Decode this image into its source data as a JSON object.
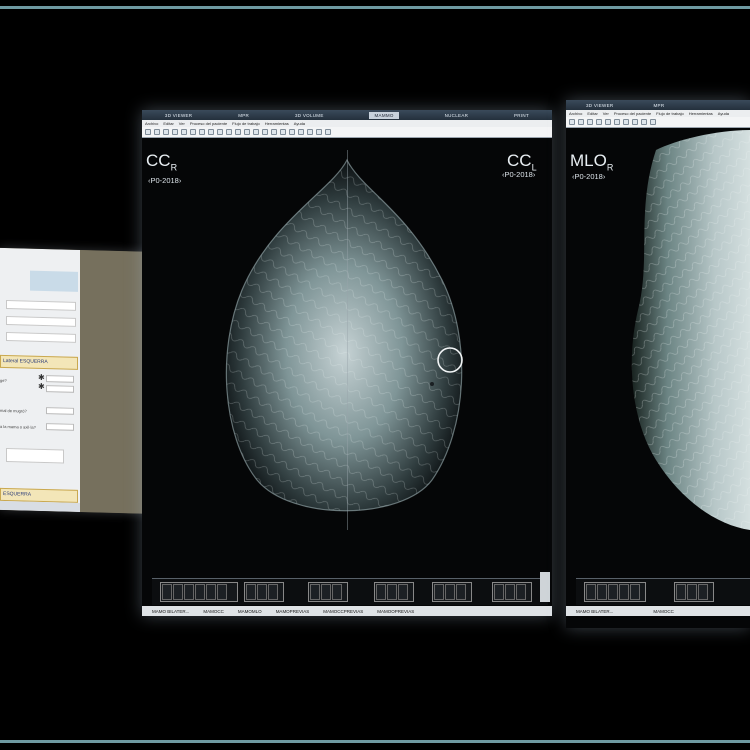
{
  "form": {
    "section_1": "Lateral ESQUERRA",
    "section_2": "ESQUERRA",
    "questions": [
      "ge?",
      "mal de mugró?",
      "a la mama o axil·la?"
    ]
  },
  "pacs": {
    "tabs": [
      "3D VIEWER",
      "MPR",
      "3D VOLUME",
      "MAMMO",
      "NUCLEAR",
      "PRINT"
    ],
    "active_tab": "MAMMO",
    "menu": [
      "Archivo",
      "Editar",
      "Ver",
      "Proceso del paciente",
      "Flujo de trabajo",
      "Herramientas",
      "Ayuda"
    ],
    "monitor1": {
      "left_view": {
        "label": "CC",
        "side": "R",
        "date": "‹P0-2018›"
      },
      "right_view": {
        "label": "CC",
        "side": "L",
        "date": "‹P0-2018›"
      },
      "series_captions": [
        "MAMO BILATER...",
        "MAMOCC",
        "MAMOMLO",
        "MAMOPREVIAS",
        "MAMOCCPREVIAS",
        "MAMOOPREVIAS"
      ]
    },
    "monitor2": {
      "tabs": [
        "3D VIEWER",
        "MPR"
      ],
      "menu": [
        "Archivo",
        "Editar",
        "Ver",
        "Proceso del paciente",
        "Flujo de trabajo",
        "Herramientas",
        "Ayuda"
      ],
      "view": {
        "label": "MLO",
        "side": "R",
        "date": "‹P0-2018›"
      },
      "series_captions": [
        "MAMO BILATER...",
        "MAMOCC"
      ]
    }
  },
  "colors": {
    "frame": "#6f9aa2",
    "form_section": "#f3e6b8",
    "form_section_text": "#2a3b78"
  }
}
